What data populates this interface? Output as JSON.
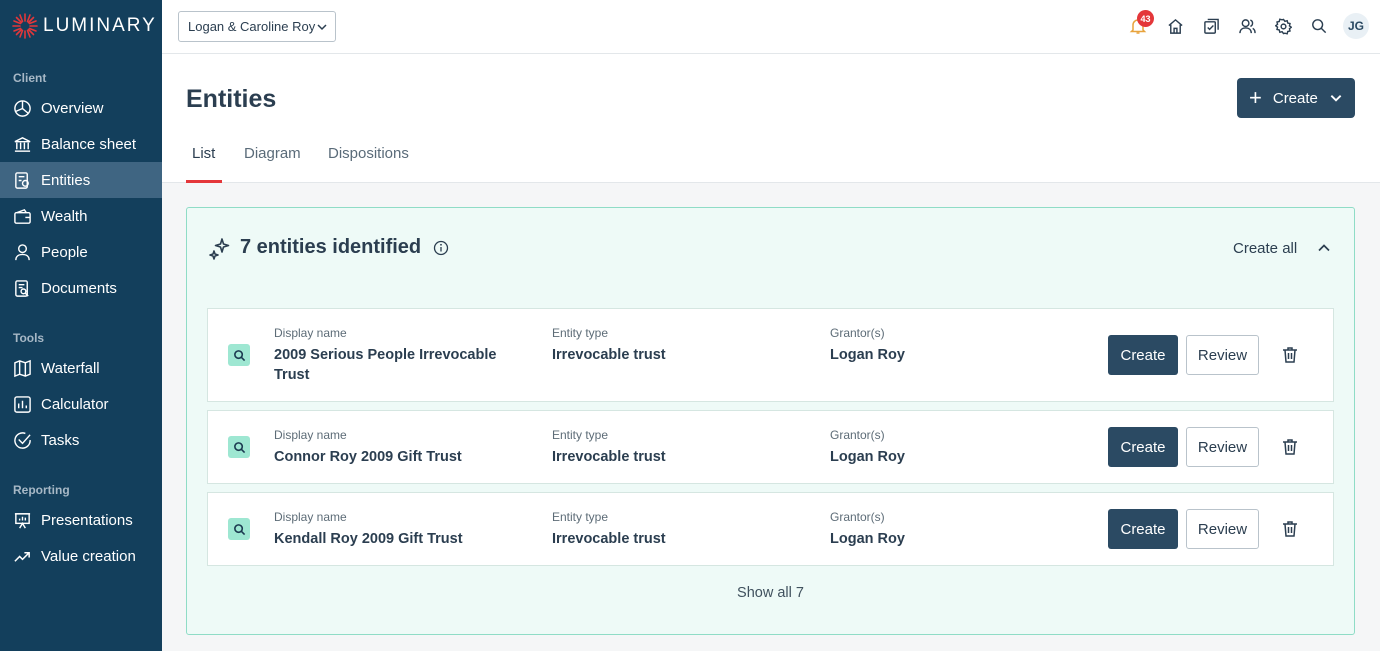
{
  "brand": {
    "name": "LUMINARY",
    "accent": "#e4373a"
  },
  "sidebar": {
    "sections": [
      {
        "label": "Client",
        "items": [
          {
            "label": "Overview",
            "icon": "overview-icon"
          },
          {
            "label": "Balance sheet",
            "icon": "bank-icon"
          },
          {
            "label": "Entities",
            "icon": "entities-icon",
            "active": true
          },
          {
            "label": "Wealth",
            "icon": "wallet-icon"
          },
          {
            "label": "People",
            "icon": "person-icon"
          },
          {
            "label": "Documents",
            "icon": "document-search-icon"
          }
        ]
      },
      {
        "label": "Tools",
        "items": [
          {
            "label": "Waterfall",
            "icon": "map-icon"
          },
          {
            "label": "Calculator",
            "icon": "chart-box-icon"
          },
          {
            "label": "Tasks",
            "icon": "check-circle-icon"
          }
        ]
      },
      {
        "label": "Reporting",
        "items": [
          {
            "label": "Presentations",
            "icon": "presentation-icon"
          },
          {
            "label": "Value creation",
            "icon": "trend-up-icon"
          }
        ]
      }
    ]
  },
  "topbar": {
    "client": "Logan & Caroline Roy",
    "notifications_count": "43",
    "avatar_initials": "JG"
  },
  "header": {
    "title": "Entities",
    "create_label": "Create",
    "tabs": [
      "List",
      "Diagram",
      "Dispositions"
    ],
    "active_tab": "List"
  },
  "panel": {
    "title": "7 entities identified",
    "create_all": "Create all",
    "show_all": "Show all 7",
    "labels": {
      "display_name": "Display name",
      "entity_type": "Entity type",
      "grantors": "Grantor(s)"
    },
    "buttons": {
      "create": "Create",
      "review": "Review"
    },
    "entities": [
      {
        "name": "2009 Serious People Irrevocable Trust",
        "type": "Irrevocable trust",
        "grantor": "Logan Roy"
      },
      {
        "name": "Connor Roy 2009 Gift Trust",
        "type": "Irrevocable trust",
        "grantor": "Logan Roy"
      },
      {
        "name": "Kendall Roy 2009 Gift Trust",
        "type": "Irrevocable trust",
        "grantor": "Logan Roy"
      }
    ]
  }
}
